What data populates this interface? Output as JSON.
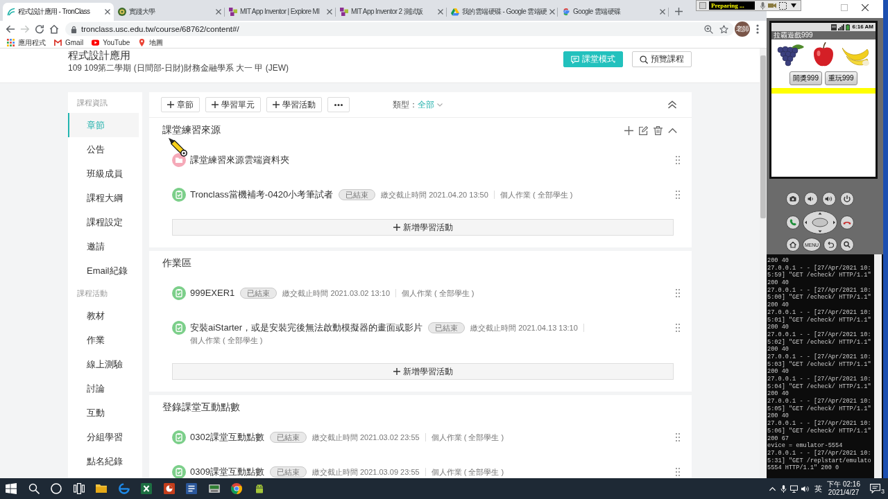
{
  "browser": {
    "tabs": [
      {
        "title": "程式設計應用 - TronClass",
        "kind": "course",
        "selected": true
      },
      {
        "title": "實踐大學",
        "kind": "school",
        "selected": false
      },
      {
        "title": "MIT App Inventor | Explore MI",
        "kind": "blocks",
        "selected": false
      },
      {
        "title": "MIT App Inventor 2 測試版",
        "kind": "blocks",
        "selected": false
      },
      {
        "title": "我的雲端硬碟 - Google 雲端硬",
        "kind": "drive",
        "selected": false
      },
      {
        "title": "Google 雲端硬碟",
        "kind": "google",
        "selected": false
      }
    ],
    "forward_disabled": true,
    "url": "tronclass.usc.edu.tw/course/68762/content#/",
    "profile": "老師",
    "bookmarks": [
      {
        "label": "應用程式",
        "kind": "apps"
      },
      {
        "label": "Gmail",
        "kind": "mail"
      },
      {
        "label": "YouTube",
        "kind": "video"
      },
      {
        "label": "地圖",
        "kind": "map"
      }
    ]
  },
  "recorder": {
    "status": "Preparing ..."
  },
  "course": {
    "title": "程式設計應用",
    "subtitle": "109 109第二學期 (日間部-日財)財務金融學系 大一 甲 (JEW)",
    "actions": [
      {
        "label": "課堂模式",
        "kind": "primary"
      },
      {
        "label": "預覽課程",
        "kind": "outline"
      }
    ]
  },
  "sidebar": [
    {
      "heading": "課程資訊",
      "items": [
        {
          "label": "章節",
          "selected": true
        },
        {
          "label": "公告",
          "selected": false
        },
        {
          "label": "班級成員",
          "selected": false
        },
        {
          "label": "課程大綱",
          "selected": false
        },
        {
          "label": "課程設定",
          "selected": false
        },
        {
          "label": "邀請",
          "selected": false
        },
        {
          "label": "Email紀錄",
          "selected": false
        }
      ]
    },
    {
      "heading": "課程活動",
      "items": [
        {
          "label": "教材",
          "selected": false
        },
        {
          "label": "作業",
          "selected": false
        },
        {
          "label": "線上測驗",
          "selected": false
        },
        {
          "label": "討論",
          "selected": false
        },
        {
          "label": "互動",
          "selected": false
        },
        {
          "label": "分組學習",
          "selected": false
        },
        {
          "label": "點名紀錄",
          "selected": false
        }
      ]
    }
  ],
  "toolbar": {
    "buttons": [
      {
        "kind": "add",
        "label": "章節"
      },
      {
        "kind": "add",
        "label": "學習單元"
      },
      {
        "kind": "add",
        "label": "學習活動"
      },
      {
        "kind": "more"
      }
    ],
    "filter_label": "類型：",
    "filter_value": "全部"
  },
  "sections": [
    {
      "title": "課堂練習來源",
      "hovered": true,
      "activities": [
        {
          "kind": "folder",
          "title": "課堂練習來源雲端資料夾"
        },
        {
          "kind": "homework",
          "title": "Tronclass當機補考-0420小考筆試者",
          "status": "已結束",
          "deadline": "繳交截止時間 2021.04.20 13:50",
          "scope": "個人作業 ( 全部學生 )"
        }
      ],
      "add_label": "新增學習活動"
    },
    {
      "title": "作業區",
      "hovered": false,
      "activities": [
        {
          "kind": "homework",
          "title": "999EXER1",
          "status": "已結束",
          "deadline": "繳交截止時間 2021.03.02 13:10",
          "scope": "個人作業 ( 全部學生 )"
        },
        {
          "kind": "homework",
          "title": "安裝aiStarter，或是安裝完後無法啟動模擬器的畫面或影片",
          "status": "已結束",
          "deadline": "繳交截止時間 2021.04.13 13:10",
          "scope": "個人作業 ( 全部學生 )"
        }
      ],
      "add_label": "新增學習活動"
    },
    {
      "title": "登錄課堂互動點數",
      "hovered": false,
      "activities": [
        {
          "kind": "homework",
          "title": "0302課堂互動點數",
          "status": "已結束",
          "deadline": "繳交截止時間 2021.03.02 23:55",
          "scope": "個人作業 ( 全部學生 )"
        },
        {
          "kind": "homework",
          "title": "0309課堂互動點數",
          "status": "已結束",
          "deadline": "繳交截止時間 2021.03.09 23:55",
          "scope": "個人作業 ( 全部學生 )"
        }
      ]
    }
  ],
  "emulator": {
    "clock": "6:16 AM",
    "app_title": "拉霸遊戲999",
    "buttons": [
      "開獎999",
      "重玩999"
    ],
    "menu_key": "MENU"
  },
  "terminal": {
    "lines": [
      "200 40",
      "27.0.0.1 - - [27/Apr/2021 10:",
      "5:59] \"GET /echeck/ HTTP/1.1\"",
      "200 40",
      "27.0.0.1 - - [27/Apr/2021 10:",
      "5:00] \"GET /echeck/ HTTP/1.1\"",
      "200 40",
      "27.0.0.1 - - [27/Apr/2021 10:",
      "5:01] \"GET /echeck/ HTTP/1.1\"",
      "200 40",
      "27.0.0.1 - - [27/Apr/2021 10:",
      "5:02] \"GET /echeck/ HTTP/1.1\"",
      "200 40",
      "27.0.0.1 - - [27/Apr/2021 10:",
      "5:03] \"GET /echeck/ HTTP/1.1\"",
      "200 40",
      "27.0.0.1 - - [27/Apr/2021 10:",
      "5:04] \"GET /echeck/ HTTP/1.1\"",
      "200 40",
      "27.0.0.1 - - [27/Apr/2021 10:",
      "5:05] \"GET /echeck/ HTTP/1.1\"",
      "200 40",
      "27.0.0.1 - - [27/Apr/2021 10:",
      "5:06] \"GET /echeck/ HTTP/1.1\"",
      "200 67",
      "evice = emulator-5554",
      "27.0.0.1 - - [27/Apr/2021 10:",
      "5:31] \"GET /replstart/emulato",
      "5554 HTTP/1.1\" 200 0"
    ]
  },
  "taskbar": {
    "ime": "英",
    "time": "下午 02:16",
    "date": "2021/4/27",
    "notifications": "3"
  }
}
